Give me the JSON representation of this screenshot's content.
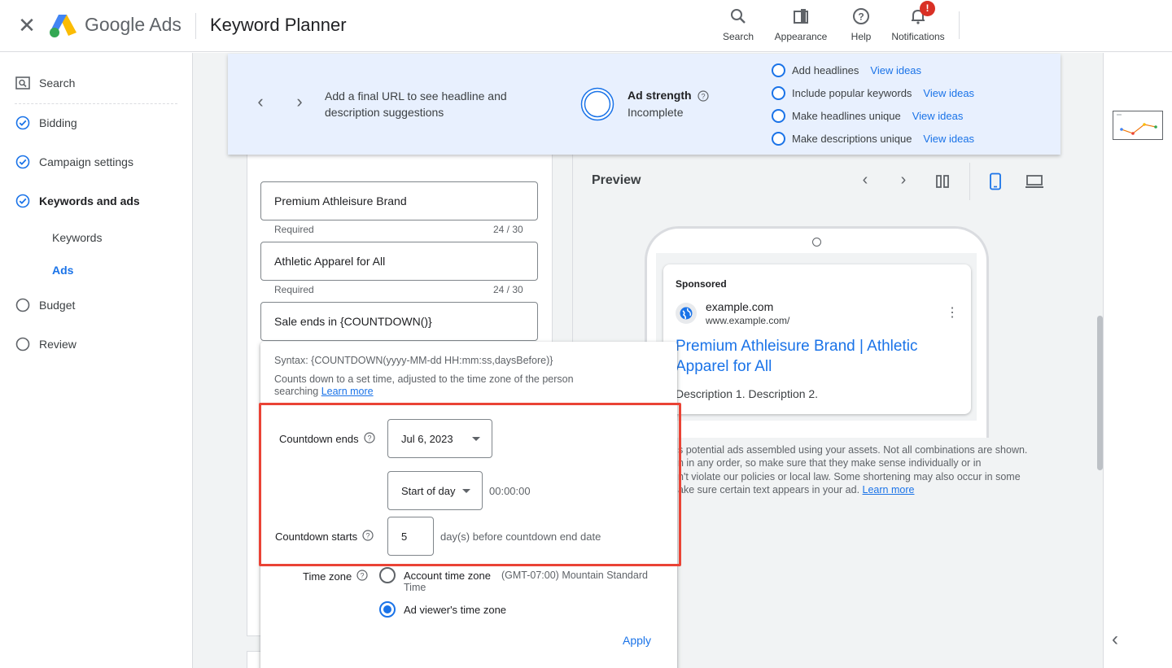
{
  "header": {
    "brand": "Google Ads",
    "app_title": "Keyword Planner",
    "tools": [
      {
        "label": "Search",
        "icon": "search-icon"
      },
      {
        "label": "Appearance",
        "icon": "appearance-icon"
      },
      {
        "label": "Help",
        "icon": "help-icon"
      },
      {
        "label": "Notifications",
        "icon": "bell-icon"
      }
    ],
    "notification_badge": "!"
  },
  "sidebar": {
    "items": [
      {
        "label": "Search",
        "icon": "search-box-icon"
      },
      {
        "label": "Bidding",
        "icon": "check-circle-icon"
      },
      {
        "label": "Campaign settings",
        "icon": "check-circle-icon"
      },
      {
        "label": "Keywords and ads",
        "icon": "check-circle-icon"
      },
      {
        "label": "Keywords"
      },
      {
        "label": "Ads"
      },
      {
        "label": "Budget",
        "icon": "empty-circle-icon"
      },
      {
        "label": "Review",
        "icon": "empty-circle-icon"
      }
    ]
  },
  "banner": {
    "message": "Add a final URL to see headline and description suggestions",
    "ad_strength_label": "Ad strength",
    "ad_strength_value": "Incomplete",
    "suggestions": [
      {
        "text": "Add headlines",
        "link": "View ideas"
      },
      {
        "text": "Include popular keywords",
        "link": "View ideas"
      },
      {
        "text": "Make headlines unique",
        "link": "View ideas"
      },
      {
        "text": "Make descriptions unique",
        "link": "View ideas"
      }
    ]
  },
  "headlines": [
    {
      "value": "Premium Athleisure Brand",
      "helper": "Required",
      "count": "24 / 30"
    },
    {
      "value": "Athletic Apparel for All",
      "helper": "Required",
      "count": "24 / 30"
    },
    {
      "value": "Sale ends in {COUNTDOWN()}"
    }
  ],
  "preview": {
    "title": "Preview",
    "sponsored": "Sponsored",
    "domain": "example.com",
    "url": "www.example.com/",
    "headline": "Premium Athleisure Brand | Athletic Apparel for All",
    "description": "Description 1. Description 2.",
    "disclaimer_lines": [
      "s potential ads assembled using your assets. Not all combinations are shown.",
      "n in any order, so make sure that they make sense individually or in",
      "n't violate our policies or local law. Some shortening may also occur in some",
      "ake sure certain text appears in your ad."
    ],
    "disclaimer_link": "Learn more"
  },
  "popup": {
    "syntax": "Syntax: {COUNTDOWN(yyyy-MM-dd HH:mm:ss,daysBefore)}",
    "description": "Counts down to a set time, adjusted to the time zone of the person searching",
    "learn_more": "Learn more",
    "countdown_ends_label": "Countdown ends",
    "date_value": "Jul 6, 2023",
    "time_of_day": "Start of day",
    "time_value": "00:00:00",
    "countdown_starts_label": "Countdown starts",
    "days_value": "5",
    "days_suffix": "day(s) before countdown end date",
    "time_zone_label": "Time zone",
    "tz_account": "Account time zone",
    "tz_account_detail": "(GMT-07:00) Mountain Standard",
    "tz_account_detail2": "Time",
    "tz_viewer": "Ad viewer's time zone",
    "tz_selected": "viewer",
    "apply": "Apply"
  },
  "colors": {
    "accent": "#1a73e8",
    "highlight": "#ea4335",
    "banner": "#e8f0fe",
    "badge": "#d93025"
  }
}
